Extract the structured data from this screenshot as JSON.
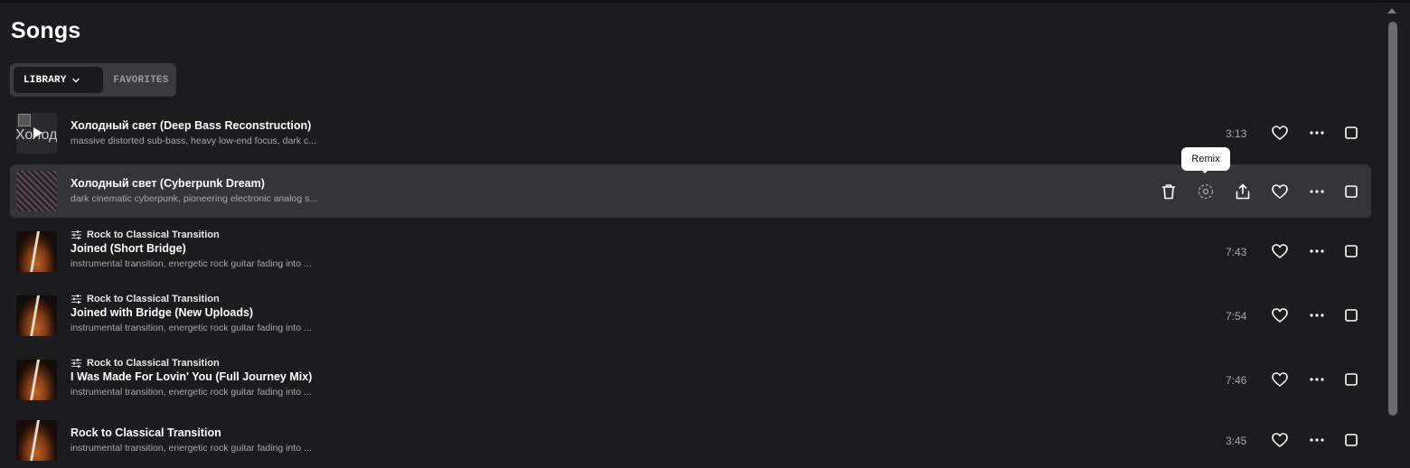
{
  "page": {
    "title": "Songs"
  },
  "tabs": {
    "library": "LIBRARY",
    "favorites": "FAVORITES"
  },
  "tooltip": {
    "remix": "Remix"
  },
  "songs": [
    {
      "project": "",
      "title": "Холодный свет (Deep Bass Reconstruction)",
      "description": "massive distorted sub-bass, heavy low-end focus, dark c...",
      "duration": "3:13",
      "thumb_alt": "Холод",
      "thumb": "broken"
    },
    {
      "project": "",
      "title": "Холодный свет (Cyberpunk Dream)",
      "description": "dark cinematic cyberpunk, pioneering electronic analog s...",
      "duration": "",
      "thumb": "cyber"
    },
    {
      "project": "Rock to Classical Transition",
      "title": "Joined (Short Bridge)",
      "description": "instrumental transition, energetic rock guitar fading into ...",
      "duration": "7:43",
      "thumb": "guitar"
    },
    {
      "project": "Rock to Classical Transition",
      "title": "Joined with Bridge (New Uploads)",
      "description": "instrumental transition, energetic rock guitar fading into ...",
      "duration": "7:54",
      "thumb": "guitar"
    },
    {
      "project": "Rock to Classical Transition",
      "title": "I Was Made For Lovin' You (Full Journey Mix)",
      "description": "instrumental transition, energetic rock guitar fading into ...",
      "duration": "7:46",
      "thumb": "guitar"
    },
    {
      "project": "",
      "title": "Rock to Classical Transition",
      "description": "instrumental transition, energetic rock guitar fading into ...",
      "duration": "3:45",
      "thumb": "guitar"
    }
  ]
}
